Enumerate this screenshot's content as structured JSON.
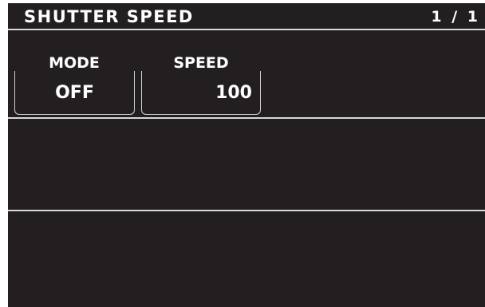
{
  "header": {
    "title": "SHUTTER SPEED",
    "page_indicator": "1 / 1"
  },
  "fields": {
    "mode": {
      "label": "MODE",
      "value": "OFF"
    },
    "speed": {
      "label": "SPEED",
      "value": "100"
    }
  },
  "colors": {
    "background": "#231f20",
    "text": "#ffffff",
    "divider": "#d9d9d9"
  }
}
